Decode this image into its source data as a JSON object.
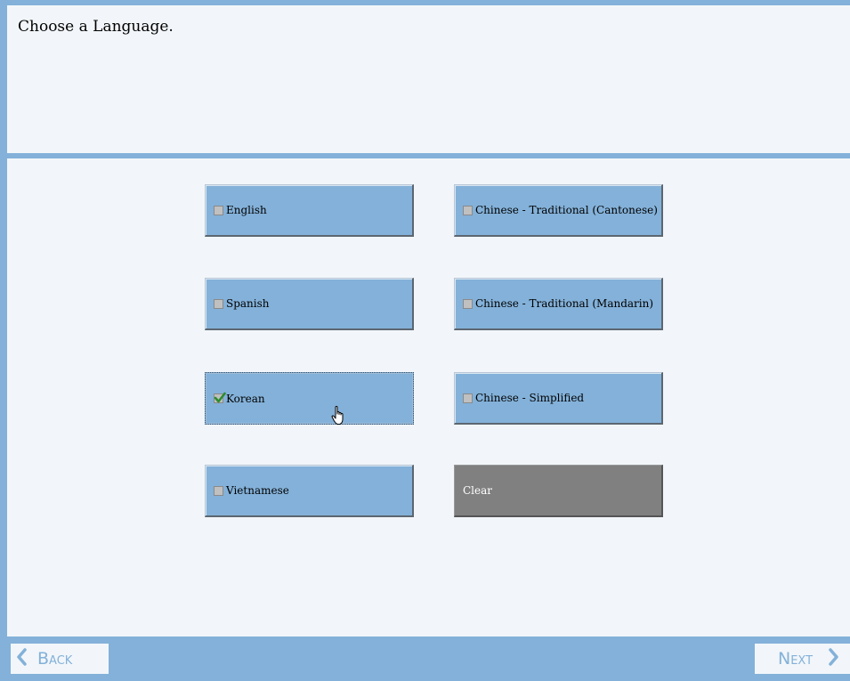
{
  "header": {
    "prompt": "Choose a Language."
  },
  "options": {
    "english": {
      "label": "English",
      "checked": false
    },
    "spanish": {
      "label": "Spanish",
      "checked": false
    },
    "korean": {
      "label": "Korean",
      "checked": true
    },
    "vietnamese": {
      "label": "Vietnamese",
      "checked": false
    },
    "cantonese": {
      "label": "Chinese - Traditional (Cantonese)",
      "checked": false
    },
    "mandarin": {
      "label": "Chinese - Traditional (Mandarin)",
      "checked": false
    },
    "simplified": {
      "label": "Chinese - Simplified",
      "checked": false
    }
  },
  "clear_label": "Clear",
  "nav": {
    "back_label": "Back",
    "next_label": "Next"
  },
  "colors": {
    "accent": "#83b1d9",
    "background": "#f2f6fa",
    "clear": "#808080",
    "check": "#2e8b2e"
  }
}
